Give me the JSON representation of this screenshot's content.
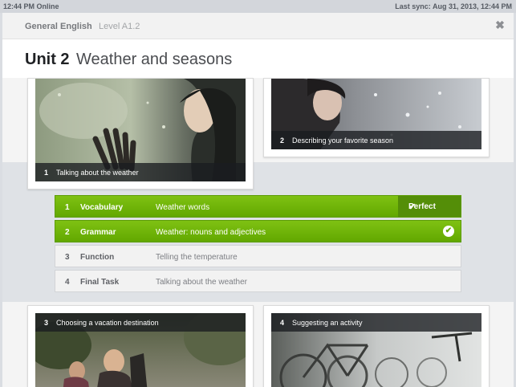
{
  "status": {
    "left": "12:44 PM Online",
    "right": "Last sync: Aug 31, 2013, 12:44 PM"
  },
  "header": {
    "course": "General English",
    "level": "Level A1.2",
    "close_icon": "close-icon"
  },
  "unit": {
    "number": "Unit 2",
    "title": "Weather and seasons"
  },
  "sections": [
    {
      "num": "1",
      "title": "Talking about the weather"
    },
    {
      "num": "2",
      "title": "Describing your favorite season"
    },
    {
      "num": "3",
      "title": "Choosing a vacation destination"
    },
    {
      "num": "4",
      "title": "Suggesting an activity"
    }
  ],
  "lessons": [
    {
      "num": "1",
      "name": "Vocabulary",
      "desc": "Weather words",
      "result": "Perfect",
      "status": "completed"
    },
    {
      "num": "2",
      "name": "Grammar",
      "desc": "Weather: nouns and adjectives",
      "status": "completed"
    },
    {
      "num": "3",
      "name": "Function",
      "desc": "Telling the temperature",
      "status": "not-started"
    },
    {
      "num": "4",
      "name": "Final Task",
      "desc": "Talking about the weather",
      "status": "not-started"
    }
  ],
  "colors": {
    "accent_green": "#6cb00b",
    "dark_green": "#548e08",
    "caption_bg": "#1c1f23"
  }
}
